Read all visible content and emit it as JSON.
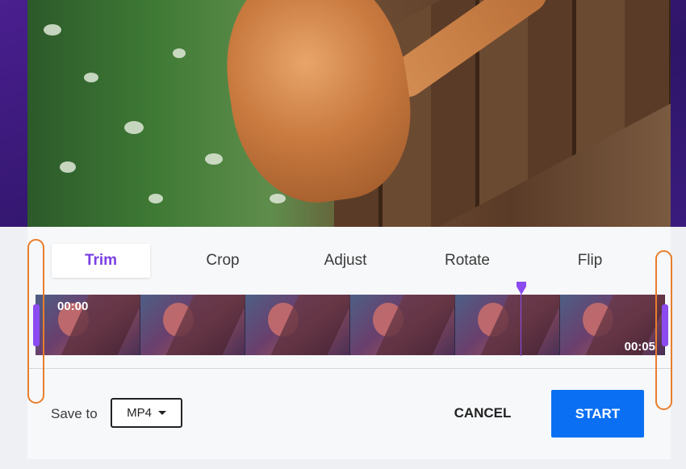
{
  "tabs": [
    {
      "label": "Trim",
      "active": true
    },
    {
      "label": "Crop",
      "active": false
    },
    {
      "label": "Adjust",
      "active": false
    },
    {
      "label": "Rotate",
      "active": false
    },
    {
      "label": "Flip",
      "active": false
    }
  ],
  "timeline": {
    "start_time": "00:00",
    "end_time": "00:05",
    "playhead_position_fraction": 0.77
  },
  "footer": {
    "save_to_label": "Save to",
    "format_value": "MP4",
    "cancel_label": "CANCEL",
    "start_label": "START"
  },
  "colors": {
    "accent_purple": "#7b3fe4",
    "start_button_blue": "#0a6ff2",
    "annotation_orange": "#e87e2c"
  },
  "icons": {
    "format_dropdown": "caret-down-icon"
  }
}
